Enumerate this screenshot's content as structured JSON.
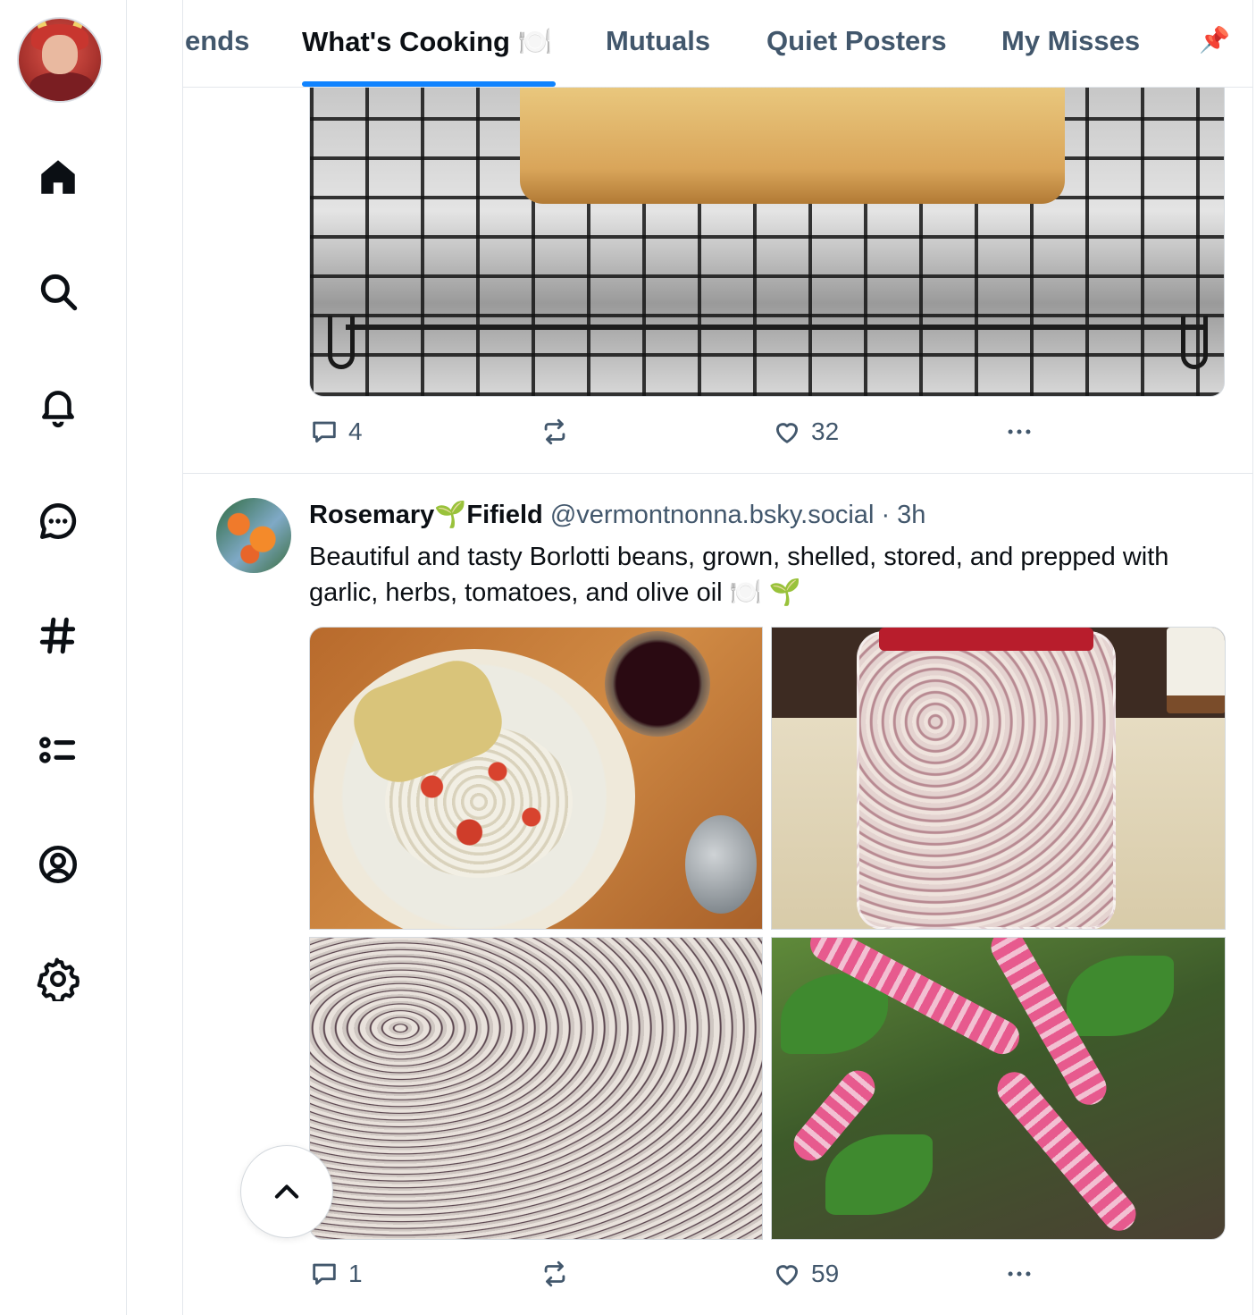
{
  "feed_tabs": [
    {
      "label": "ends",
      "active": false
    },
    {
      "label": "What's Cooking 🍽️",
      "active": true
    },
    {
      "label": "Mutuals",
      "active": false
    },
    {
      "label": "Quiet Posters",
      "active": false
    },
    {
      "label": "My Misses",
      "active": false
    }
  ],
  "pin_icon": "📌",
  "accent_color": "#1083fe",
  "nav": {
    "items": [
      "home-icon",
      "search-icon",
      "bell-icon",
      "chat-icon",
      "hashtag-icon",
      "list-icon",
      "profile-icon",
      "gear-icon"
    ]
  },
  "post1": {
    "image_alt": "bread-loaf-on-cooling-rack",
    "replies": "4",
    "likes": "32"
  },
  "post2": {
    "author": "Rosemary🌱Fifield",
    "handle": "@vermontnonna.bsky.social",
    "time": "3h",
    "text": "Beautiful and tasty Borlotti beans, grown, shelled, stored, and prepped with garlic, herbs, tomatoes, and olive oil 🍽️ 🌱",
    "images": [
      "beans-dish-with-bread",
      "jar-of-dried-beans",
      "dried-beans-spread",
      "bean-pods-on-plant"
    ],
    "replies": "1",
    "likes": "59"
  }
}
